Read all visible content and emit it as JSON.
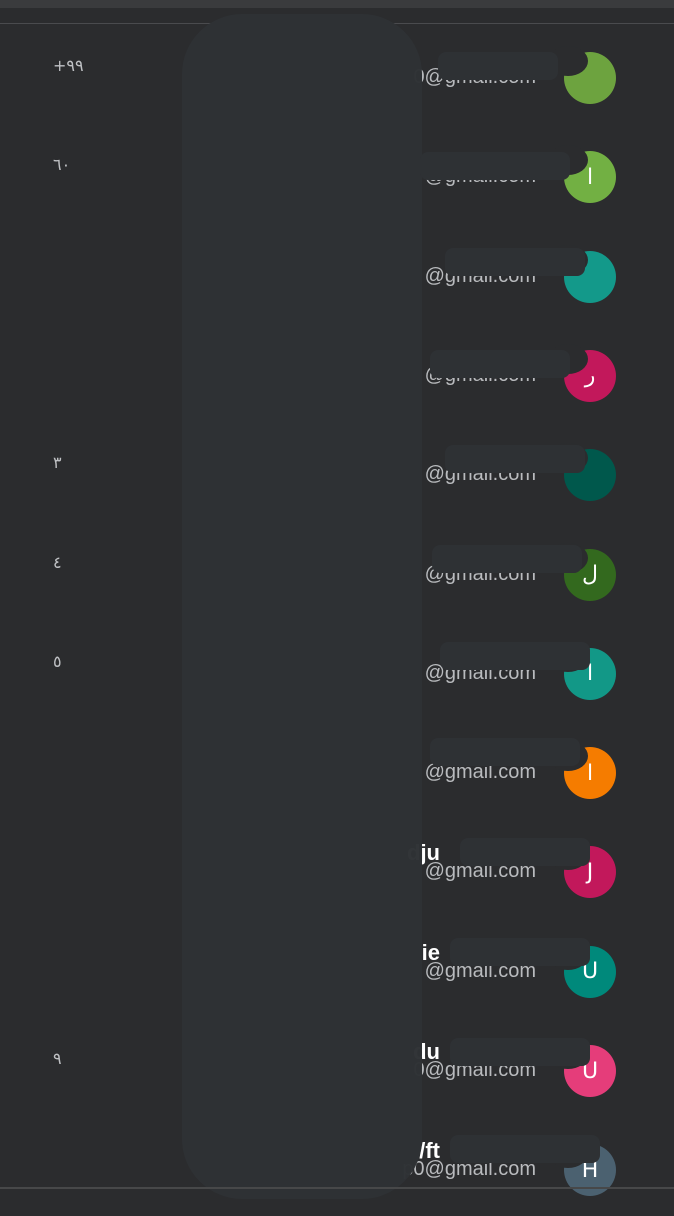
{
  "accounts": [
    {
      "name": "",
      "email": "0@gmail.com",
      "badge": "+٩٩",
      "avatar_letter": "",
      "avatar_color": "#6da33f"
    },
    {
      "name": "",
      "email": "@gmail.com",
      "badge": "٦٠",
      "avatar_letter": "ا",
      "avatar_color": "#72b043"
    },
    {
      "name": "",
      "email": "@gmail.com",
      "badge": "",
      "avatar_letter": "",
      "avatar_color": "#13998a"
    },
    {
      "name": "",
      "email": "@gmail.com",
      "badge": "",
      "avatar_letter": "ر",
      "avatar_color": "#c2185b"
    },
    {
      "name": "",
      "email": "@gmail.com",
      "badge": "٣",
      "avatar_letter": "",
      "avatar_color": "#00584c"
    },
    {
      "name": "",
      "email": "@gmail.com",
      "badge": "٤",
      "avatar_letter": "ل",
      "avatar_color": "#33691e"
    },
    {
      "name": "",
      "email": "@gmail.com",
      "badge": "٥",
      "avatar_letter": "ا",
      "avatar_color": "#129887"
    },
    {
      "name": "",
      "email": "@gmail.com",
      "badge": "",
      "avatar_letter": "ا",
      "avatar_color": "#f57c00"
    },
    {
      "name": "dju",
      "email": "@gmail.com",
      "badge": "",
      "avatar_letter": "J",
      "avatar_color": "#c2185b"
    },
    {
      "name": "ie",
      "email": "@gmail.com",
      "badge": "",
      "avatar_letter": "U",
      "avatar_color": "#00897b"
    },
    {
      "name": "du",
      "email": "0@gmail.com",
      "badge": "٩",
      "avatar_letter": "U",
      "avatar_color": "#e53d7a"
    },
    {
      "name": "/ft",
      "email": "p0@gmail.com",
      "badge": "",
      "avatar_letter": "H",
      "avatar_color": "#4b6170"
    }
  ]
}
